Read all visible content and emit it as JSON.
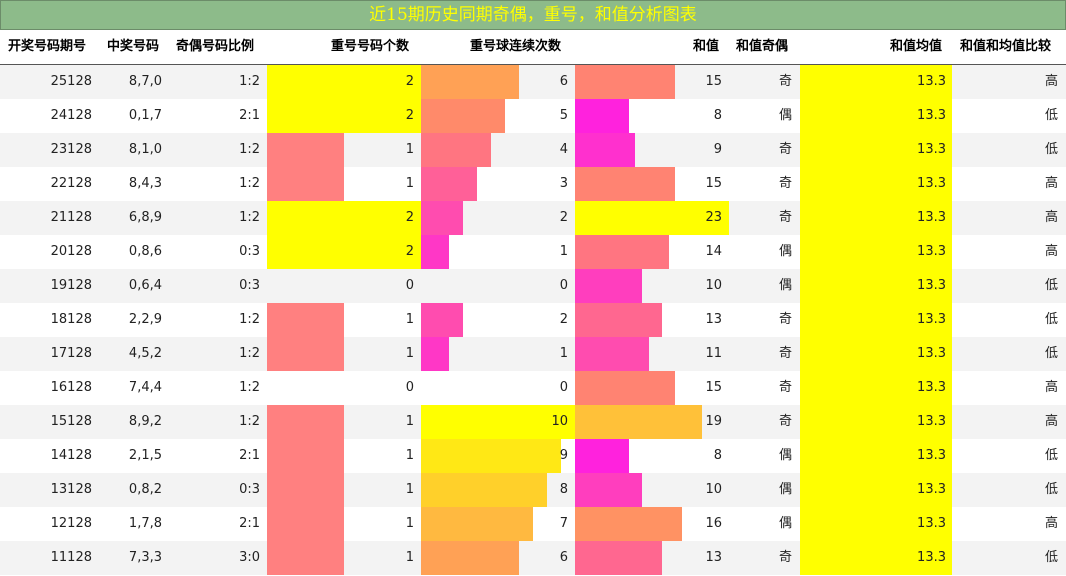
{
  "title": "近15期历史同期奇偶，重号，和值分析图表",
  "headers": {
    "period": "开奖号码期号",
    "numbers": "中奖号码",
    "ratio": "奇偶号码比例",
    "repeat_count": "重号号码个数",
    "repeat_streak": "重号球连续次数",
    "sum": "和值",
    "sum_parity": "和值奇偶",
    "avg": "和值均值",
    "compare": "和值和均值比较"
  },
  "colors": {
    "title_bg": "#8dbb8a",
    "title_text": "#ffff00",
    "highlight": "#ffff00",
    "repeat_one": "#ff8080",
    "streak_max": "#ffff00",
    "streak_min": "#ff00ff",
    "row_alt": "#f3f3f3"
  },
  "rows": [
    {
      "period": "25128",
      "numbers": "8,7,0",
      "ratio": "1:2",
      "repeat_count": 2,
      "repeat_streak": 6,
      "sum": 15,
      "sum_parity": "奇",
      "avg": "13.3",
      "compare": "高"
    },
    {
      "period": "24128",
      "numbers": "0,1,7",
      "ratio": "2:1",
      "repeat_count": 2,
      "repeat_streak": 5,
      "sum": 8,
      "sum_parity": "偶",
      "avg": "13.3",
      "compare": "低"
    },
    {
      "period": "23128",
      "numbers": "8,1,0",
      "ratio": "1:2",
      "repeat_count": 1,
      "repeat_streak": 4,
      "sum": 9,
      "sum_parity": "奇",
      "avg": "13.3",
      "compare": "低"
    },
    {
      "period": "22128",
      "numbers": "8,4,3",
      "ratio": "1:2",
      "repeat_count": 1,
      "repeat_streak": 3,
      "sum": 15,
      "sum_parity": "奇",
      "avg": "13.3",
      "compare": "高"
    },
    {
      "period": "21128",
      "numbers": "6,8,9",
      "ratio": "1:2",
      "repeat_count": 2,
      "repeat_streak": 2,
      "sum": 23,
      "sum_parity": "奇",
      "avg": "13.3",
      "compare": "高"
    },
    {
      "period": "20128",
      "numbers": "0,8,6",
      "ratio": "0:3",
      "repeat_count": 2,
      "repeat_streak": 1,
      "sum": 14,
      "sum_parity": "偶",
      "avg": "13.3",
      "compare": "高"
    },
    {
      "period": "19128",
      "numbers": "0,6,4",
      "ratio": "0:3",
      "repeat_count": 0,
      "repeat_streak": 0,
      "sum": 10,
      "sum_parity": "偶",
      "avg": "13.3",
      "compare": "低"
    },
    {
      "period": "18128",
      "numbers": "2,2,9",
      "ratio": "1:2",
      "repeat_count": 1,
      "repeat_streak": 2,
      "sum": 13,
      "sum_parity": "奇",
      "avg": "13.3",
      "compare": "低"
    },
    {
      "period": "17128",
      "numbers": "4,5,2",
      "ratio": "1:2",
      "repeat_count": 1,
      "repeat_streak": 1,
      "sum": 11,
      "sum_parity": "奇",
      "avg": "13.3",
      "compare": "低"
    },
    {
      "period": "16128",
      "numbers": "7,4,4",
      "ratio": "1:2",
      "repeat_count": 0,
      "repeat_streak": 0,
      "sum": 15,
      "sum_parity": "奇",
      "avg": "13.3",
      "compare": "高"
    },
    {
      "period": "15128",
      "numbers": "8,9,2",
      "ratio": "1:2",
      "repeat_count": 1,
      "repeat_streak": 10,
      "sum": 19,
      "sum_parity": "奇",
      "avg": "13.3",
      "compare": "高"
    },
    {
      "period": "14128",
      "numbers": "2,1,5",
      "ratio": "2:1",
      "repeat_count": 1,
      "repeat_streak": 9,
      "sum": 8,
      "sum_parity": "偶",
      "avg": "13.3",
      "compare": "低"
    },
    {
      "period": "13128",
      "numbers": "0,8,2",
      "ratio": "0:3",
      "repeat_count": 1,
      "repeat_streak": 8,
      "sum": 10,
      "sum_parity": "偶",
      "avg": "13.3",
      "compare": "低"
    },
    {
      "period": "12128",
      "numbers": "1,7,8",
      "ratio": "2:1",
      "repeat_count": 1,
      "repeat_streak": 7,
      "sum": 16,
      "sum_parity": "偶",
      "avg": "13.3",
      "compare": "高"
    },
    {
      "period": "11128",
      "numbers": "7,3,3",
      "ratio": "3:0",
      "repeat_count": 1,
      "repeat_streak": 6,
      "sum": 13,
      "sum_parity": "奇",
      "avg": "13.3",
      "compare": "低"
    }
  ]
}
